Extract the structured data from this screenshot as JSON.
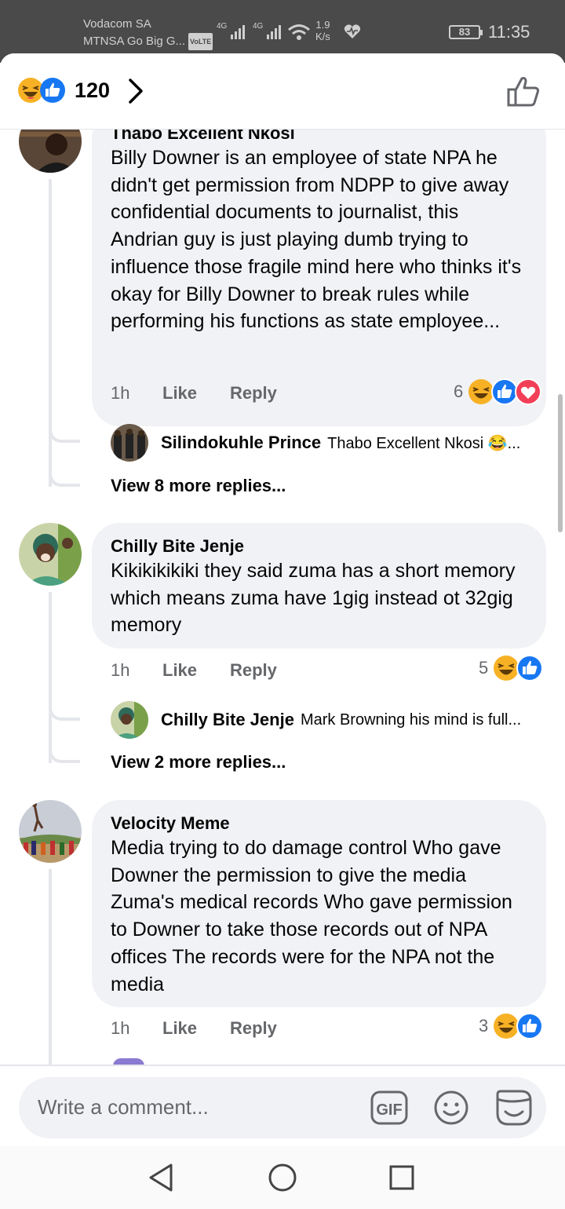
{
  "status_bar": {
    "carrier_line1": "Vodacom SA",
    "carrier_line2": "MTNSA Go Big G...",
    "volte": "VoLTE",
    "net1": "4G",
    "net2": "4G",
    "speed_value": "1.9",
    "speed_unit": "K/s",
    "battery": "83",
    "time": "11:35"
  },
  "header": {
    "reaction_count": "120",
    "icons": [
      "haha-icon",
      "like-icon",
      "chevron-right-icon",
      "thumbs-up-outline-icon"
    ]
  },
  "comments": [
    {
      "author": "Thabo Excellent Nkosi",
      "text": "Billy Downer is an employee of state NPA he didn't get permission from NDPP to give away confidential documents to journalist, this Andrian guy is just playing dumb trying to influence those fragile mind here who thinks it's okay for Billy Downer to break rules while performing his functions as state employee...",
      "time": "1h",
      "like": "Like",
      "reply": "Reply",
      "reaction_count": "6",
      "reactions": [
        "haha",
        "like",
        "love"
      ],
      "reply_preview": {
        "author": "Silindokuhle Prince",
        "text": "Thabo Excellent Nkosi 😂..."
      },
      "view_more": "View 8 more replies..."
    },
    {
      "author": "Chilly Bite Jenje",
      "text": "Kikikikikiki they said zuma has a short memory which means zuma have 1gig instead ot 32gig  memory",
      "time": "1h",
      "like": "Like",
      "reply": "Reply",
      "reaction_count": "5",
      "reactions": [
        "haha",
        "like"
      ],
      "reply_preview": {
        "author": "Chilly Bite Jenje",
        "text": "Mark Browning his mind is full..."
      },
      "view_more": "View 2 more replies..."
    },
    {
      "author": "Velocity Meme",
      "text": "Media trying to do damage control Who gave Downer the permission to give the media Zuma's medical records Who gave permission to Downer to take those records out of NPA offices The records were for the NPA not the media",
      "time": "1h",
      "like": "Like",
      "reply": "Reply",
      "reaction_count": "3",
      "reactions": [
        "haha",
        "like"
      ]
    }
  ],
  "composer": {
    "placeholder": "Write a comment...",
    "gif_label": "GIF"
  },
  "colors": {
    "like_blue": "#1877f2",
    "love_red": "#f33e58",
    "haha_yellow": "#f7b125",
    "bubble_bg": "#f0f2f5",
    "secondary_text": "#65676b"
  }
}
